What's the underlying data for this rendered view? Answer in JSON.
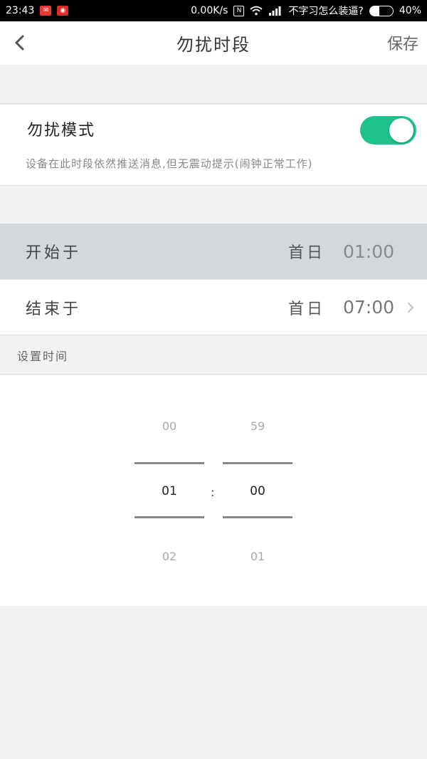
{
  "status_bar": {
    "time": "23:43",
    "network_speed": "0.00K/s",
    "carrier": "不字习怎么装逼?",
    "battery_percent": "40%",
    "battery_level": 0.4
  },
  "nav": {
    "title": "勿扰时段",
    "save_label": "保存"
  },
  "dnd": {
    "label": "勿扰模式",
    "description": "设备在此时段依然推送消息,但无震动提示(闹钟正常工作)",
    "enabled": true,
    "accent_color": "#1ec28b"
  },
  "start_row": {
    "label": "开始于",
    "day": "首日",
    "time": "01:00"
  },
  "end_row": {
    "label": "结束于",
    "day": "首日",
    "time": "07:00"
  },
  "section_header": "设置时间",
  "picker": {
    "hours": {
      "prev": "00",
      "selected": "01",
      "next": "02"
    },
    "minutes": {
      "prev": "59",
      "selected": "00",
      "next": "01"
    },
    "separator": ":"
  }
}
